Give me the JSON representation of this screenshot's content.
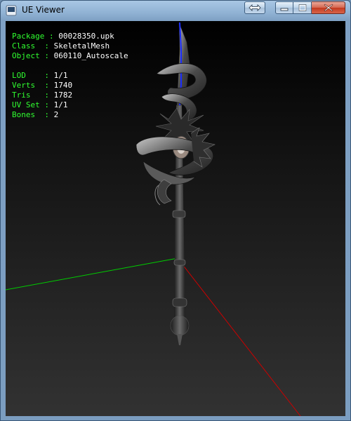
{
  "window": {
    "title": "UE Viewer",
    "controls": {
      "restore_icon": "swap-arrows-icon",
      "minimize_icon": "minimize-icon",
      "maximize_icon": "maximize-icon",
      "close_icon": "close-icon"
    }
  },
  "info": {
    "package_label": "Package",
    "package_value": "00028350.upk",
    "class_label": "Class  ",
    "class_value": "SkeletalMesh",
    "object_label": "Object ",
    "object_value": "060110_Autoscale",
    "lod_label": "LOD    ",
    "lod_value": "1/1",
    "verts_label": "Verts  ",
    "verts_value": "1740",
    "tris_label": "Tris   ",
    "tris_value": "1782",
    "uvset_label": "UV Set ",
    "uvset_value": "1/1",
    "bones_label": "Bones  ",
    "bones_value": "2"
  },
  "colors": {
    "label": "#30ff30",
    "value": "#ffffff",
    "axis_x": "#cc0000",
    "axis_y": "#00cc00",
    "axis_z": "#1a2cff"
  }
}
